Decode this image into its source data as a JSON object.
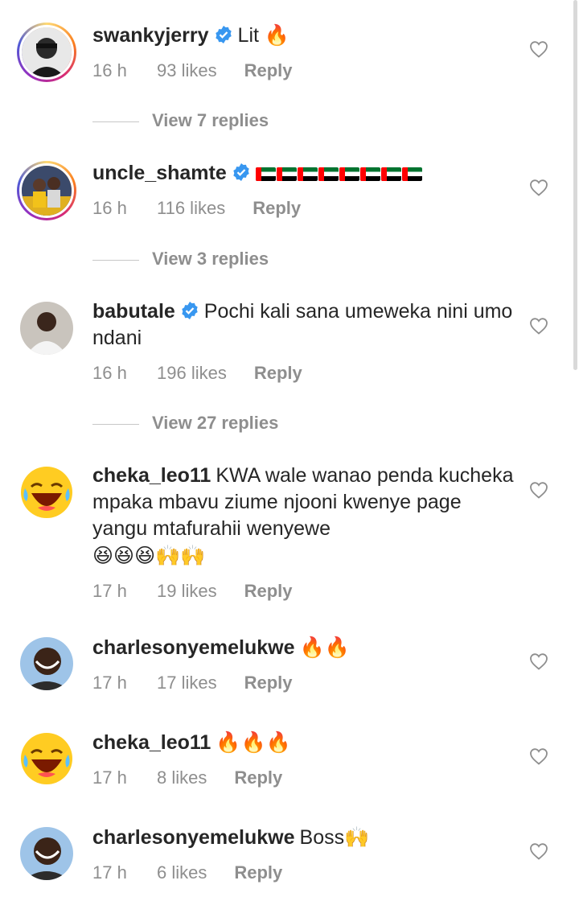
{
  "comments": [
    {
      "username": "swankyjerry",
      "verified": true,
      "text": "Lit",
      "emoji": "🔥",
      "time": "16 h",
      "likes": "93 likes",
      "reply": "Reply"
    },
    {
      "username": "uncle_shamte",
      "verified": true,
      "text": "",
      "emoji": "",
      "flag_count": 8,
      "time": "16 h",
      "likes": "116 likes",
      "reply": "Reply"
    },
    {
      "username": "babutale",
      "verified": true,
      "text": "Pochi kali sana umeweka nini umo ndani",
      "emoji": "",
      "time": "16 h",
      "likes": "196 likes",
      "reply": "Reply"
    },
    {
      "username": "cheka_leo11",
      "verified": false,
      "text": "KWA wale wanao penda kucheka mpaka mbavu ziume njooni kwenye page yangu mtafurahii wenyewe",
      "emoji": "😆😆😆🙌🙌",
      "time": "17 h",
      "likes": "19 likes",
      "reply": "Reply"
    },
    {
      "username": "charlesonyemelukwe",
      "verified": false,
      "text": "",
      "emoji": "🔥🔥",
      "time": "17 h",
      "likes": "17 likes",
      "reply": "Reply"
    },
    {
      "username": "cheka_leo11",
      "verified": false,
      "text": "",
      "emoji": "🔥🔥🔥",
      "time": "17 h",
      "likes": "8 likes",
      "reply": "Reply"
    },
    {
      "username": "charlesonyemelukwe",
      "verified": false,
      "text": "Boss",
      "emoji": "🙌",
      "time": "17 h",
      "likes": "6 likes",
      "reply": "Reply"
    }
  ],
  "view_replies": [
    "View 7 replies",
    "View 3 replies",
    "View 27 replies"
  ],
  "colors": {
    "text": "#262626",
    "meta": "#8e8e8e",
    "verified": "#3897f0"
  }
}
